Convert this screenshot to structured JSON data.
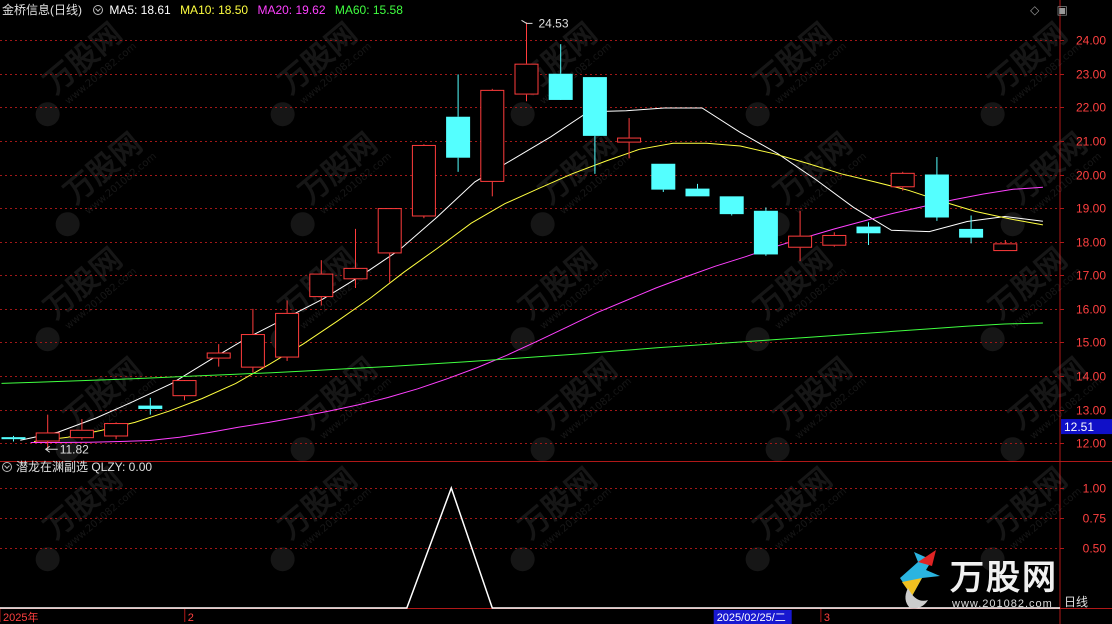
{
  "header": {
    "stock": "金桥信息(日线)",
    "ma5": "MA5: 18.61",
    "ma10": "MA10: 18.50",
    "ma20": "MA20: 19.62",
    "ma60": "MA60: 15.58",
    "colors": {
      "stock": "#e0e0e0",
      "ma5": "#ffffff",
      "ma10": "#ffff40",
      "ma20": "#ff40ff",
      "ma60": "#40ff40"
    }
  },
  "indicator": {
    "title": "潜龙在渊副选 QLZY: 0.00",
    "color": "#e0e0e0"
  },
  "icons": {
    "diamond": "◇",
    "scroll": "▣"
  },
  "watermark": {
    "brand": "万股网",
    "url": "www.201082.com"
  },
  "xaxis": {
    "labels": [
      {
        "text": "2025年",
        "idx": 0
      },
      {
        "text": "2",
        "idx": 5.3
      },
      {
        "text": "2025/02/25/二",
        "idx": 21
      },
      {
        "text": "3",
        "idx": 23.9
      }
    ]
  },
  "current_price_label": "12.51",
  "daily_label": "日线",
  "chart_data": [
    {
      "type": "candlestick",
      "title": "金桥信息(日线)",
      "ylim": [
        11.5,
        24.6
      ],
      "yticks": [
        "12.00",
        "13.00",
        "14.00",
        "15.00",
        "16.00",
        "17.00",
        "18.00",
        "19.00",
        "20.00",
        "21.00",
        "22.00",
        "23.00",
        "24.00"
      ],
      "annotations": {
        "high": "24.53",
        "low": "11.82"
      },
      "candles": [
        {
          "o": 12.18,
          "h": 12.22,
          "l": 12.05,
          "c": 12.12
        },
        {
          "o": 12.05,
          "h": 12.85,
          "l": 11.82,
          "c": 12.32
        },
        {
          "o": 12.15,
          "h": 12.72,
          "l": 12.1,
          "c": 12.4
        },
        {
          "o": 12.2,
          "h": 12.62,
          "l": 12.12,
          "c": 12.6
        },
        {
          "o": 13.12,
          "h": 13.35,
          "l": 12.85,
          "c": 13.02
        },
        {
          "o": 13.4,
          "h": 13.85,
          "l": 13.28,
          "c": 13.88
        },
        {
          "o": 14.52,
          "h": 14.95,
          "l": 14.28,
          "c": 14.7
        },
        {
          "o": 14.25,
          "h": 16.0,
          "l": 14.1,
          "c": 15.25
        },
        {
          "o": 14.55,
          "h": 16.25,
          "l": 14.45,
          "c": 15.88
        },
        {
          "o": 16.35,
          "h": 17.45,
          "l": 16.1,
          "c": 17.05
        },
        {
          "o": 16.88,
          "h": 18.38,
          "l": 16.62,
          "c": 17.22
        },
        {
          "o": 17.65,
          "h": 19.0,
          "l": 16.78,
          "c": 19.0
        },
        {
          "o": 18.75,
          "h": 20.9,
          "l": 18.7,
          "c": 20.88
        },
        {
          "o": 21.72,
          "h": 22.98,
          "l": 20.08,
          "c": 20.5
        },
        {
          "o": 19.78,
          "h": 22.55,
          "l": 19.35,
          "c": 22.52
        },
        {
          "o": 22.38,
          "h": 24.53,
          "l": 22.18,
          "c": 23.3
        },
        {
          "o": 23.0,
          "h": 23.88,
          "l": 22.28,
          "c": 22.22
        },
        {
          "o": 22.9,
          "h": 22.9,
          "l": 20.02,
          "c": 21.15
        },
        {
          "o": 20.95,
          "h": 21.68,
          "l": 20.48,
          "c": 21.1
        },
        {
          "o": 20.32,
          "h": 20.32,
          "l": 19.48,
          "c": 19.55
        },
        {
          "o": 19.58,
          "h": 19.72,
          "l": 19.35,
          "c": 19.35
        },
        {
          "o": 19.35,
          "h": 19.35,
          "l": 18.78,
          "c": 18.82
        },
        {
          "o": 18.92,
          "h": 19.02,
          "l": 17.58,
          "c": 17.62
        },
        {
          "o": 17.82,
          "h": 18.92,
          "l": 17.42,
          "c": 18.18
        },
        {
          "o": 17.88,
          "h": 18.28,
          "l": 17.85,
          "c": 18.2
        },
        {
          "o": 18.45,
          "h": 18.58,
          "l": 17.9,
          "c": 18.25
        },
        {
          "o": 19.62,
          "h": 20.08,
          "l": 19.52,
          "c": 20.05
        },
        {
          "o": 20.0,
          "h": 20.52,
          "l": 18.62,
          "c": 18.72
        },
        {
          "o": 18.38,
          "h": 18.78,
          "l": 17.95,
          "c": 18.12
        },
        {
          "o": 17.72,
          "h": 18.05,
          "l": 17.72,
          "c": 17.95
        }
      ],
      "ma": {
        "MA5": {
          "color": "#ffffff",
          "values": [
            null,
            null,
            null,
            null,
            12.09,
            12.33,
            12.75,
            13.25,
            13.78,
            14.47,
            15.14,
            15.72,
            16.3,
            16.99,
            17.75,
            18.73,
            19.78,
            20.45,
            21.12,
            21.87,
            21.9,
            21.98,
            21.98,
            21.26,
            20.62,
            19.85,
            19.02,
            18.34,
            18.3,
            18.6,
            18.75,
            18.61
          ]
        },
        "MA10": {
          "color": "#ffff40",
          "values": [
            null,
            null,
            null,
            null,
            null,
            null,
            null,
            null,
            null,
            12.05,
            12.18,
            12.38,
            12.62,
            12.95,
            13.33,
            13.78,
            14.35,
            14.95,
            15.62,
            16.32,
            17.09,
            17.81,
            18.55,
            19.13,
            19.58,
            20.02,
            20.4,
            20.75,
            20.93,
            20.93,
            20.85,
            20.62,
            20.33,
            20.02,
            19.78,
            19.53,
            19.2,
            18.9,
            18.68,
            18.5
          ]
        },
        "MA20": {
          "color": "#ff40ff",
          "values": [
            12.02,
            12.02,
            12.03,
            12.05,
            12.08,
            12.18,
            12.32,
            12.48,
            12.62,
            12.78,
            12.95,
            13.14,
            13.36,
            13.62,
            13.92,
            14.25,
            14.62,
            15.03,
            15.45,
            15.88,
            16.25,
            16.62,
            16.95,
            17.27,
            17.55,
            17.85,
            18.12,
            18.38,
            18.62,
            18.85,
            19.05,
            19.25,
            19.42,
            19.56,
            19.62
          ]
        },
        "MA60": {
          "color": "#40ff40",
          "values": [
            13.78,
            13.82,
            13.86,
            13.9,
            13.95,
            14.0,
            14.05,
            14.1,
            14.16,
            14.22,
            14.28,
            14.35,
            14.42,
            14.5,
            14.58,
            14.66,
            14.75,
            14.84,
            14.92,
            15.0,
            15.08,
            15.16,
            15.24,
            15.32,
            15.4,
            15.48,
            15.55,
            15.58
          ]
        }
      }
    },
    {
      "type": "line",
      "title": "潜龙在渊副选 QLZY: 0.00",
      "ylim": [
        0,
        1.1
      ],
      "yticks": [
        "0.50",
        "0.75",
        "1.00"
      ],
      "series": [
        {
          "name": "QLZY",
          "color": "#ffffff",
          "x": [
            0,
            11.5,
            12.8,
            14.0,
            30
          ],
          "values": [
            0,
            0,
            1,
            0,
            0
          ]
        }
      ]
    }
  ]
}
